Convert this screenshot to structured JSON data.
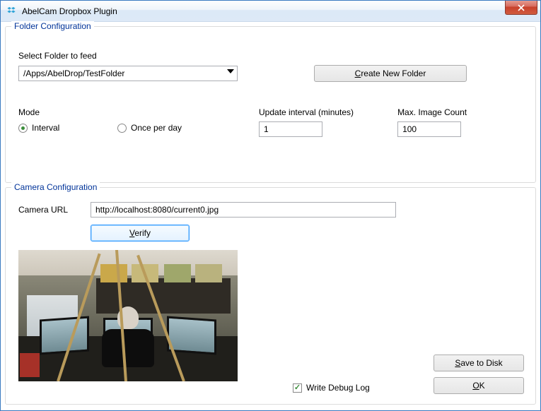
{
  "window": {
    "title": "AbelCam Dropbox Plugin"
  },
  "folder_config": {
    "legend": "Folder Configuration",
    "select_folder_label": "Select Folder to feed",
    "selected_folder": "/Apps/AbelDrop/TestFolder",
    "create_folder_label": "Create New Folder",
    "mode_label": "Mode",
    "mode_interval_label": "Interval",
    "mode_once_label": "Once per day",
    "mode_selected": "interval",
    "update_interval_label": "Update interval (minutes)",
    "update_interval_value": "1",
    "max_image_label": "Max. Image Count",
    "max_image_value": "100"
  },
  "camera_config": {
    "legend": "Camera Configuration",
    "camera_url_label": "Camera URL",
    "camera_url_value": "http://localhost:8080/current0.jpg",
    "verify_label": "Verify",
    "write_debug_label": "Write Debug Log",
    "write_debug_checked": true,
    "save_to_disk_label": "Save to Disk",
    "ok_label": "OK"
  }
}
